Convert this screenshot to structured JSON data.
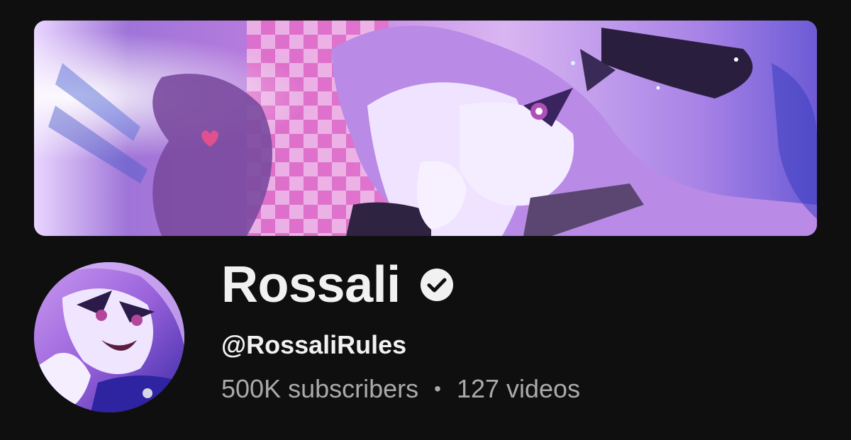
{
  "channel": {
    "name": "Rossali",
    "verified": true,
    "handle": "@RossaliRules",
    "subscribers": "500K subscribers",
    "separator": "•",
    "videos": "127 videos"
  },
  "icons": {
    "verified": "verified-check-icon"
  },
  "colors": {
    "background": "#0f0f0f",
    "primary_text": "#f1f1f1",
    "secondary_text": "#aaaaaa",
    "banner_accent": "#b88be0"
  }
}
